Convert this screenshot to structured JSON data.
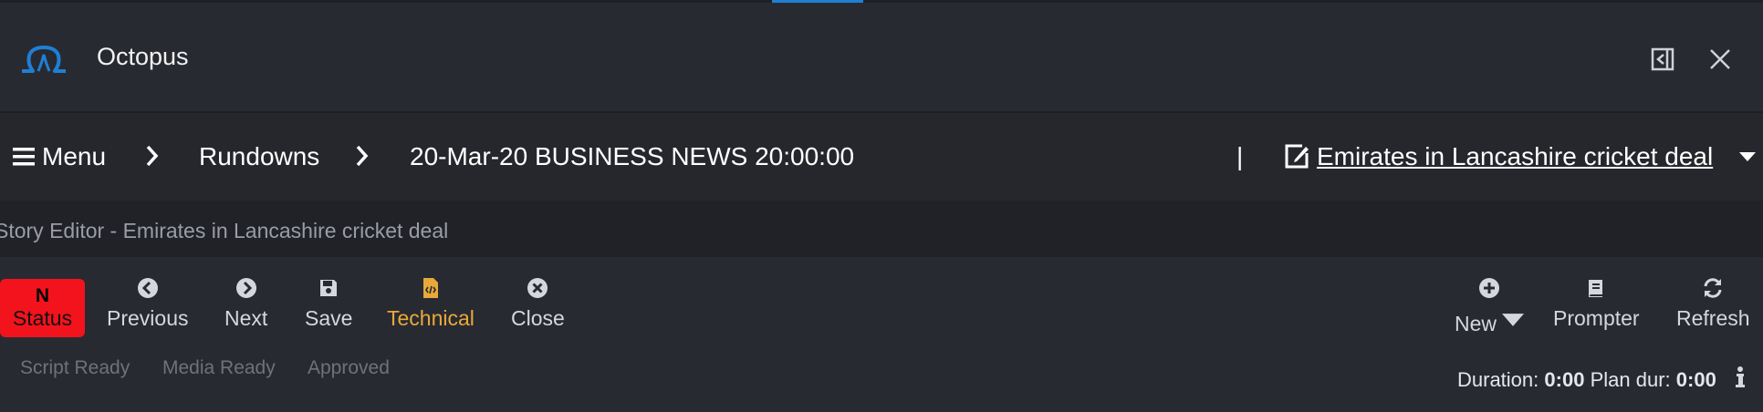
{
  "app": {
    "title": "Octopus"
  },
  "window_controls": {
    "dock_icon": "dock-left-icon",
    "close_icon": "close-icon"
  },
  "breadcrumb": {
    "menu_label": "Menu",
    "rundowns": "Rundowns",
    "rundown_name": "20-Mar-20 BUSINESS NEWS 20:00:00",
    "separator": "|",
    "story_title": "Emirates in Lancashire cricket deal"
  },
  "editor": {
    "header": "Story Editor - Emirates in Lancashire cricket deal"
  },
  "toolbar": {
    "status": {
      "badge": "N",
      "label": "Status",
      "color": "#f2131c"
    },
    "previous": "Previous",
    "next": "Next",
    "save": "Save",
    "technical": "Technical",
    "close": "Close",
    "new": "New",
    "prompter": "Prompter",
    "refresh": "Refresh"
  },
  "flags": [
    "Script Ready",
    "Media Ready",
    "Approved"
  ],
  "durations": {
    "duration_label": "Duration:",
    "duration_value": "0:00",
    "plan_label": "Plan dur:",
    "plan_value": "0:00"
  },
  "colors": {
    "accent": "#1f7fd6",
    "technical": "#e8a93a",
    "background": "#282a31"
  }
}
